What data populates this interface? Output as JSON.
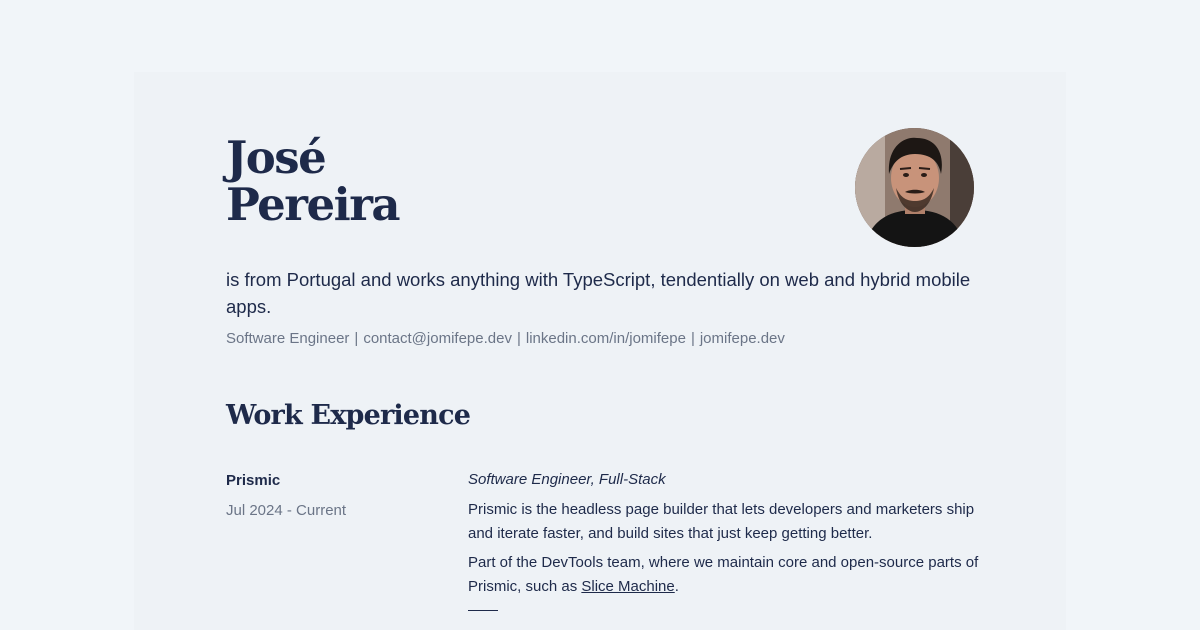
{
  "profile": {
    "first_name": "José",
    "last_name": "Pereira",
    "intro": "is from Portugal and works anything with TypeScript, tendentially on web and hybrid mobile apps.",
    "contacts": [
      "Software Engineer",
      "contact@jomifepe.dev",
      "linkedin.com/in/jomifepe",
      "jomifepe.dev"
    ],
    "contact_separator": "|"
  },
  "work": {
    "title": "Work Experience",
    "jobs": [
      {
        "company": "Prismic",
        "dates": "Jul 2024 - Current",
        "role": "Software Engineer, Full-Stack",
        "description": "Prismic is the headless page builder that lets developers and marketers ship and iterate faster, and build sites that just keep getting better.",
        "team_text_before": "Part of the DevTools team, where we maintain core and open-source parts of Prismic, such as ",
        "team_link": "Slice Machine",
        "team_text_after": "."
      }
    ]
  },
  "colors": {
    "page_bg": "#f1f5f9",
    "card_bg": "#eef2f6",
    "ink": "#1e2a4a",
    "muted": "#6b7587"
  }
}
